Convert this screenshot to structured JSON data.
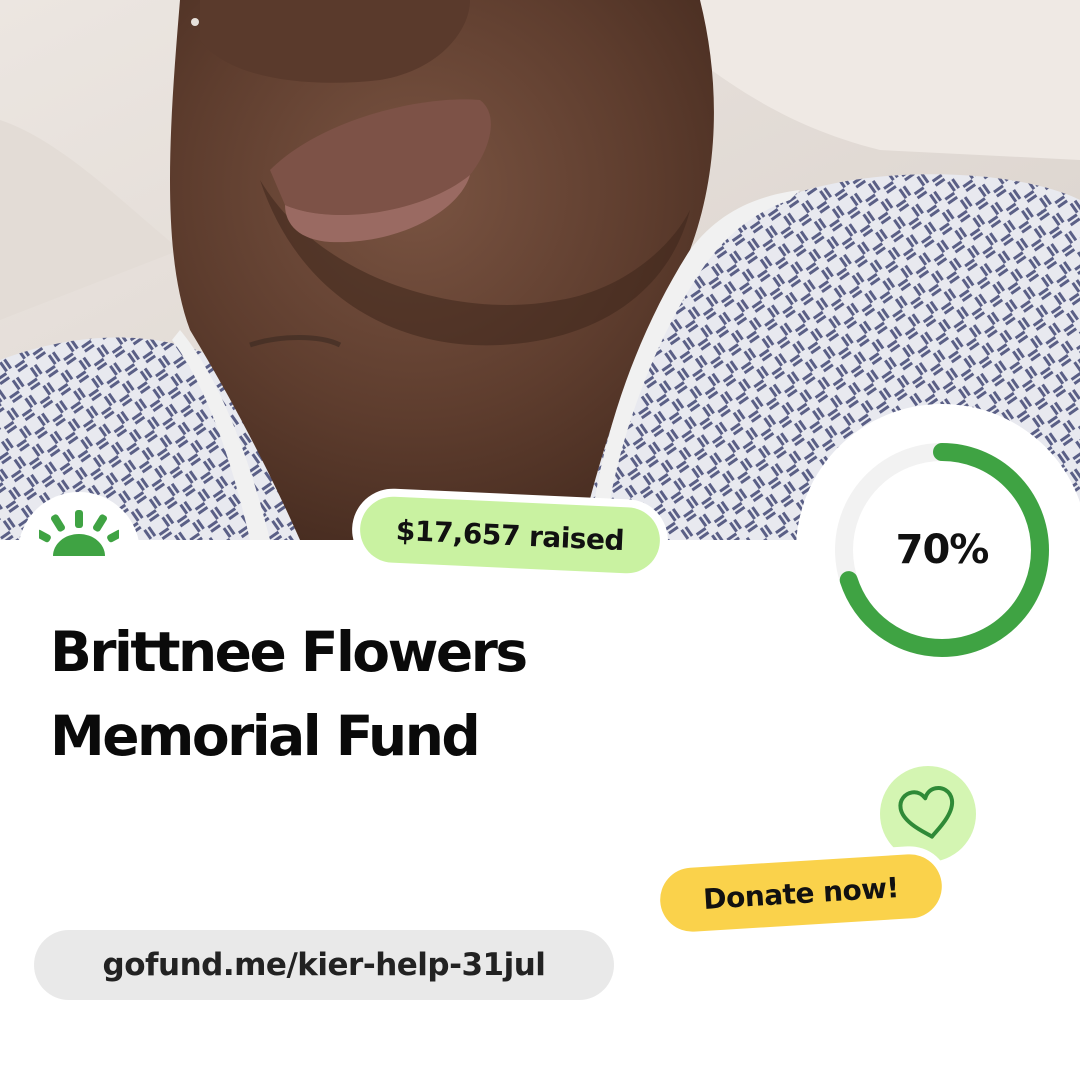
{
  "campaign": {
    "title_lines": [
      "Brittnee Flowers",
      "Memorial Fund"
    ],
    "raised_label": "$17,657 raised",
    "progress_percent_label": "70%",
    "progress_fraction": 0.7,
    "donate_label": "Donate now!",
    "url": "gofund.me/kier-help-31jul"
  },
  "icons": {
    "logo": "gofundme-sun-logo-icon",
    "heart": "heart-icon"
  },
  "colors": {
    "brand_green": "#3fa343",
    "raised_pill": "#c9f2a1",
    "donate_pill": "#fad24b",
    "heart_bg": "#d4f5b2",
    "url_pill": "#e9e9e9",
    "ring_track": "#f2f2f2"
  }
}
